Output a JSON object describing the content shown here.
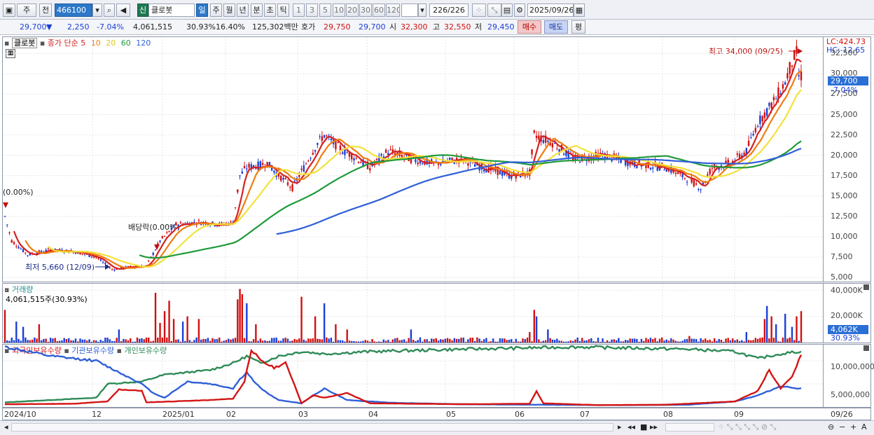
{
  "toolbar": {
    "mode": "주",
    "prev": "전",
    "code": "466100",
    "sin": "신",
    "name": "클로봇",
    "periods": [
      "일",
      "주",
      "월",
      "년",
      "분",
      "초",
      "틱"
    ],
    "active_period": "일",
    "intervals": [
      "1",
      "3",
      "5",
      "10",
      "20",
      "30",
      "60",
      "120"
    ],
    "count": "226",
    "total": "/226",
    "date": "2025/09/26"
  },
  "infobar": {
    "price": "29,700",
    "arrow": "▼",
    "change": "2,250",
    "change_pct": "-7.04%",
    "volume": "4,061,515",
    "turnover_pct": "30.93%",
    "pct2": "16.40%",
    "amount": "125,302백만",
    "hoga_label": "호가",
    "ask": "29,750",
    "bid": "29,700",
    "open_label": "시",
    "open": "32,300",
    "high_label": "고",
    "high": "32,550",
    "low_label": "저",
    "low": "29,450",
    "buy_label": "매수",
    "sell_label": "매도",
    "flat_label": "평"
  },
  "price_panel": {
    "title": "클로봇",
    "legend_prefix": "종가 단순",
    "ma_periods": [
      "5",
      "10",
      "20",
      "60",
      "120"
    ],
    "ma_colors": [
      "#d62020",
      "#f07d10",
      "#f2e23a",
      "#1f9a3a",
      "#2f5fd8"
    ],
    "lc": "LC:424.73",
    "hc": "HC:-12.65",
    "yticks": [
      "32,500",
      "30,000",
      "27,500",
      "25,000",
      "22,500",
      "20,000",
      "17,500",
      "15,000",
      "12,500",
      "10,000",
      "7,500",
      "5,000"
    ],
    "current_price": "29,700",
    "current_pct": "-7.04%",
    "high_note": "최고 34,000 (09/25)",
    "low_note": "최저 5,660 (12/09)",
    "dividend_note": "배당락(0.00%)",
    "left_note": "(0.00%)"
  },
  "volume_panel": {
    "title": "거래량",
    "value_label": "4,061,515주(30.93%)",
    "yticks": [
      "40,000K",
      "20,000K"
    ],
    "current": "4,062K",
    "current_pct": "30.93%"
  },
  "holding_panel": {
    "series": [
      "외국인보유수량",
      "기관보유수량",
      "개인보유수량"
    ],
    "series_colors": [
      "#d41515",
      "#2f5fd8",
      "#2e8b57"
    ],
    "yticks": [
      "10,000,000",
      "5,000,000"
    ]
  },
  "xaxis": {
    "labels": [
      "2024/10",
      "12",
      "2025/01",
      "02",
      "03",
      "04",
      "05",
      "06",
      "07",
      "08",
      "09"
    ],
    "last": "09/26"
  },
  "chart_data": {
    "type": "candlestick",
    "y_range": [
      4500,
      34500
    ],
    "volume_range_k": [
      0,
      45000
    ],
    "holding_range": [
      0,
      13500000
    ],
    "anchors": [
      [
        0,
        12500
      ],
      [
        3,
        9500
      ],
      [
        10,
        7800
      ],
      [
        20,
        8400
      ],
      [
        30,
        8200
      ],
      [
        40,
        7500
      ],
      [
        47,
        6000
      ],
      [
        55,
        6300
      ],
      [
        62,
        6400
      ],
      [
        68,
        9500
      ],
      [
        75,
        11500
      ],
      [
        85,
        11800
      ],
      [
        95,
        11500
      ],
      [
        100,
        11800
      ],
      [
        103,
        17500
      ],
      [
        106,
        18500
      ],
      [
        115,
        19000
      ],
      [
        122,
        17000
      ],
      [
        126,
        16000
      ],
      [
        130,
        18000
      ],
      [
        137,
        21500
      ],
      [
        140,
        22500
      ],
      [
        146,
        21000
      ],
      [
        152,
        20000
      ],
      [
        160,
        18500
      ],
      [
        168,
        20500
      ],
      [
        178,
        19500
      ],
      [
        188,
        19000
      ],
      [
        200,
        19500
      ],
      [
        210,
        18500
      ],
      [
        222,
        17500
      ],
      [
        230,
        17800
      ],
      [
        232,
        22500
      ],
      [
        240,
        21500
      ],
      [
        250,
        19500
      ],
      [
        262,
        20000
      ],
      [
        276,
        19000
      ],
      [
        290,
        18500
      ],
      [
        300,
        17000
      ],
      [
        305,
        16000
      ],
      [
        310,
        18500
      ],
      [
        318,
        19000
      ],
      [
        325,
        20500
      ],
      [
        330,
        24000
      ],
      [
        338,
        27000
      ],
      [
        342,
        29000
      ],
      [
        345,
        31500
      ],
      [
        347,
        32500
      ],
      [
        348,
        29700
      ]
    ],
    "vol_spikes": [
      [
        0,
        25000
      ],
      [
        5,
        16000
      ],
      [
        8,
        12000
      ],
      [
        15,
        14000
      ],
      [
        50,
        10000
      ],
      [
        66,
        38000
      ],
      [
        68,
        15000
      ],
      [
        70,
        24000
      ],
      [
        72,
        32000
      ],
      [
        74,
        18000
      ],
      [
        78,
        16000
      ],
      [
        80,
        20000
      ],
      [
        85,
        18000
      ],
      [
        102,
        33000
      ],
      [
        103,
        41000
      ],
      [
        104,
        37000
      ],
      [
        106,
        30000
      ],
      [
        110,
        14000
      ],
      [
        130,
        35000
      ],
      [
        136,
        20000
      ],
      [
        140,
        30000
      ],
      [
        145,
        14000
      ],
      [
        150,
        10000
      ],
      [
        178,
        10000
      ],
      [
        230,
        8000
      ],
      [
        232,
        25000
      ],
      [
        233,
        20000
      ],
      [
        238,
        10000
      ],
      [
        300,
        5000
      ],
      [
        325,
        8000
      ],
      [
        333,
        18000
      ],
      [
        334,
        28000
      ],
      [
        336,
        20000
      ],
      [
        338,
        14000
      ],
      [
        342,
        22000
      ],
      [
        345,
        12000
      ],
      [
        347,
        20000
      ],
      [
        349,
        24000
      ],
      [
        352,
        8000
      ]
    ],
    "foreign_anchors": [
      [
        0,
        600000
      ],
      [
        30,
        700000
      ],
      [
        45,
        1200000
      ],
      [
        50,
        3800000
      ],
      [
        60,
        3500000
      ],
      [
        62,
        1000000
      ],
      [
        90,
        1500000
      ],
      [
        100,
        1800000
      ],
      [
        105,
        5500000
      ],
      [
        108,
        12500000
      ],
      [
        112,
        10000000
      ],
      [
        118,
        8500000
      ],
      [
        123,
        9500000
      ],
      [
        126,
        6000000
      ],
      [
        130,
        800000
      ],
      [
        135,
        2500000
      ],
      [
        140,
        2000000
      ],
      [
        150,
        3000000
      ],
      [
        160,
        800000
      ],
      [
        200,
        600000
      ],
      [
        230,
        700000
      ],
      [
        233,
        3500000
      ],
      [
        236,
        800000
      ],
      [
        260,
        400000
      ],
      [
        290,
        500000
      ],
      [
        320,
        1200000
      ],
      [
        330,
        3500000
      ],
      [
        335,
        8000000
      ],
      [
        340,
        4000000
      ],
      [
        345,
        6500000
      ],
      [
        349,
        11500000
      ]
    ],
    "inst_anchors": [
      [
        0,
        13000000
      ],
      [
        20,
        11000000
      ],
      [
        40,
        10000000
      ],
      [
        50,
        7500000
      ],
      [
        60,
        5000000
      ],
      [
        65,
        3000000
      ],
      [
        70,
        2000000
      ],
      [
        80,
        5500000
      ],
      [
        90,
        5000000
      ],
      [
        100,
        4000000
      ],
      [
        103,
        6000000
      ],
      [
        106,
        7500000
      ],
      [
        110,
        5000000
      ],
      [
        115,
        3000000
      ],
      [
        120,
        1500000
      ],
      [
        130,
        800000
      ],
      [
        140,
        4000000
      ],
      [
        150,
        1500000
      ],
      [
        170,
        900000
      ],
      [
        200,
        600000
      ],
      [
        230,
        500000
      ],
      [
        270,
        400000
      ],
      [
        300,
        500000
      ],
      [
        320,
        1200000
      ],
      [
        330,
        2500000
      ],
      [
        340,
        4500000
      ],
      [
        348,
        4000000
      ]
    ],
    "indiv_anchors": [
      [
        0,
        1000000
      ],
      [
        20,
        1500000
      ],
      [
        40,
        2000000
      ],
      [
        45,
        5000000
      ],
      [
        60,
        5500000
      ],
      [
        70,
        7000000
      ],
      [
        80,
        7500000
      ],
      [
        90,
        8000000
      ],
      [
        100,
        9500000
      ],
      [
        106,
        11000000
      ],
      [
        112,
        9500000
      ],
      [
        120,
        11000000
      ],
      [
        130,
        12000000
      ],
      [
        140,
        11500000
      ],
      [
        160,
        12000000
      ],
      [
        200,
        12500000
      ],
      [
        250,
        13000000
      ],
      [
        300,
        12500000
      ],
      [
        320,
        12000000
      ],
      [
        330,
        10500000
      ],
      [
        340,
        11500000
      ],
      [
        348,
        12000000
      ]
    ]
  }
}
